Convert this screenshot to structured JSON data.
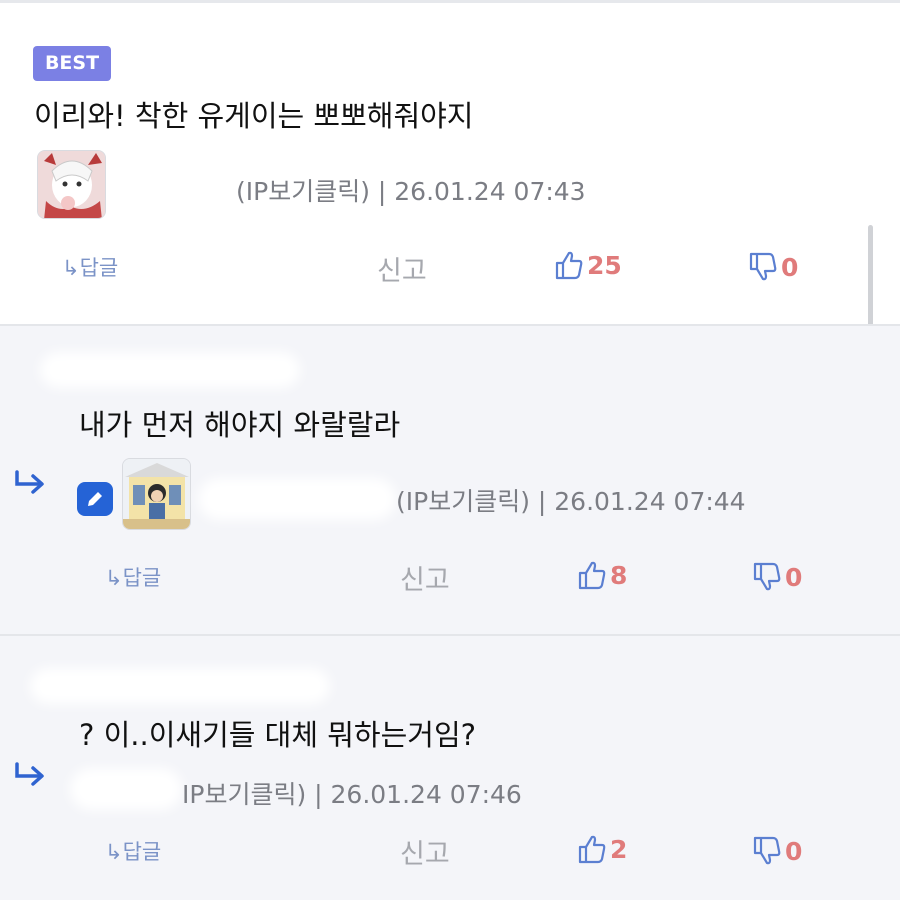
{
  "comments": [
    {
      "badge": "BEST",
      "text": "이리와! 착한 유게이는 뽀뽀해줘야지",
      "meta": "(IP보기클릭) | 26.01.24 07:43",
      "reply": "↳답글",
      "report": "신고",
      "likes": "25",
      "dislikes": "0"
    },
    {
      "text": "내가 먼저 해야지 와랄랄라",
      "meta": "(IP보기클릭) | 26.01.24 07:44",
      "reply": "↳답글",
      "report": "신고",
      "likes": "8",
      "dislikes": "0"
    },
    {
      "text": "? 이..이새기들 대체 뭐하는거임?",
      "meta": "IP보기클릭) | 26.01.24 07:46",
      "reply": "↳답글",
      "report": "신고",
      "likes": "2",
      "dislikes": "0"
    }
  ],
  "icons": {
    "like": "thumbs-up-icon",
    "dislike": "thumbs-down-icon",
    "reply_indent": "reply-arrow-icon",
    "edit": "pencil-icon"
  },
  "colors": {
    "badge": "#7b80e4",
    "count": "#e07b7b",
    "icon_blue": "#5b7fd1",
    "reply_link": "#7b93c7",
    "edit_badge": "#2563d6",
    "reply_background": "#f4f5f9"
  }
}
